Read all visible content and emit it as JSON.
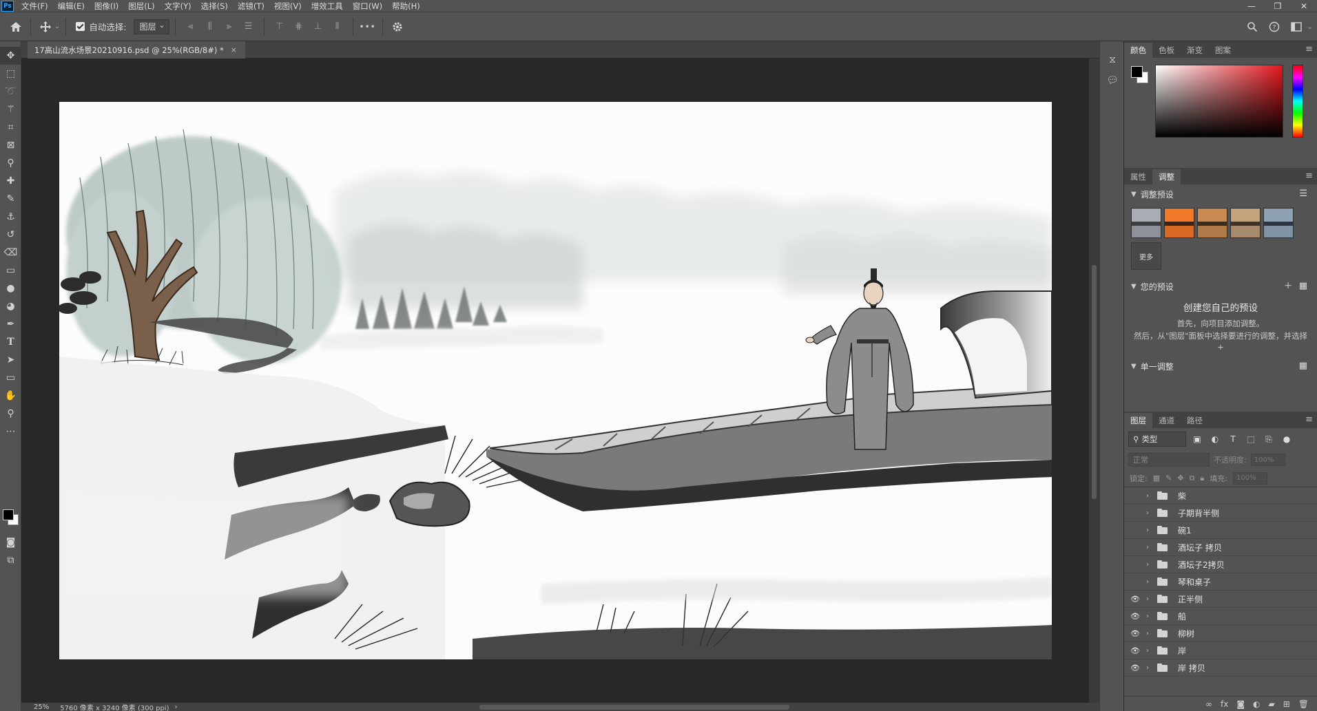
{
  "app": {
    "logo": "Ps"
  },
  "menu": [
    "文件(F)",
    "编辑(E)",
    "图像(I)",
    "图层(L)",
    "文字(Y)",
    "选择(S)",
    "滤镜(T)",
    "视图(V)",
    "增效工具",
    "窗口(W)",
    "帮助(H)"
  ],
  "window_controls": {
    "minimize": "—",
    "restore": "❐",
    "close": "✕"
  },
  "options": {
    "autoselect_label": "自动选择:",
    "autoselect_checked": true,
    "layer_select_value": "图层",
    "more_icon": "•••"
  },
  "document": {
    "tab_title": "17高山流水场景20210916.psd @ 25%(RGB/8#) *",
    "close": "×"
  },
  "status": {
    "zoom": "25%",
    "doc_size": "5760 像素 x 3240 像素 (300 ppi)",
    "nav_arrow": "›"
  },
  "color_panel": {
    "tabs": [
      "颜色",
      "色板",
      "渐变",
      "图案"
    ],
    "active_tab": "颜色",
    "foreground": "#000000",
    "background": "#ffffff",
    "hue": "#e4181f"
  },
  "adjust_panel": {
    "tabs": [
      "属性",
      "调整"
    ],
    "active_tab": "调整",
    "presets_title": "调整预设",
    "more_label": "更多",
    "yours_title": "您的预设",
    "yours_heading": "创建您自己的预设",
    "yours_line1": "首先，向项目添加调整。",
    "yours_line2": "然后，从\"图层\"面板中选择要进行的调整，并选择 +",
    "single_title": "单一调整"
  },
  "layers_panel": {
    "tabs": [
      "图层",
      "通道",
      "路径"
    ],
    "active_tab": "图层",
    "filter_label": "类型",
    "blend_mode": "正常",
    "opacity_label": "不透明度:",
    "opacity_value": "100%",
    "lock_label": "锁定:",
    "fill_label": "填充:",
    "fill_value": "100%",
    "layers": [
      {
        "name": "柴",
        "visible": false
      },
      {
        "name": "子期背半侧",
        "visible": false
      },
      {
        "name": "碗1",
        "visible": false
      },
      {
        "name": "酒坛子 拷贝",
        "visible": false
      },
      {
        "name": "酒坛子2拷贝",
        "visible": false
      },
      {
        "name": "琴和桌子",
        "visible": false
      },
      {
        "name": "正半侧",
        "visible": true
      },
      {
        "name": "船",
        "visible": true
      },
      {
        "name": "柳树",
        "visible": true
      },
      {
        "name": "岸",
        "visible": true
      },
      {
        "name": "岸 拷贝",
        "visible": true
      }
    ]
  }
}
